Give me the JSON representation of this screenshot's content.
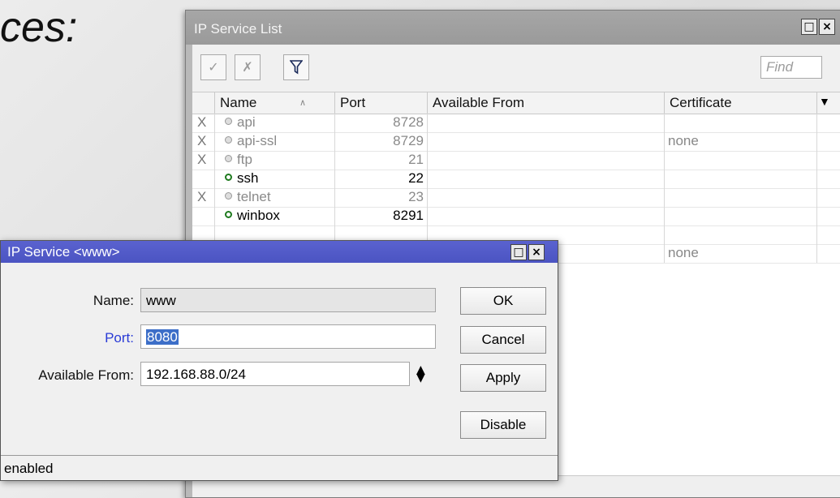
{
  "slide": {
    "text_fragment": "ces:"
  },
  "list_window": {
    "title": "IP Service List",
    "toolbar": {
      "enable_icon": "✓",
      "disable_icon": "✗",
      "filter_icon": "filter-icon",
      "find_placeholder": "Find"
    },
    "columns": [
      "Name",
      "Port",
      "Available From",
      "Certificate"
    ],
    "rows": [
      {
        "flag": "X",
        "name": "api",
        "port": "8728",
        "available_from": "",
        "certificate": "",
        "enabled": false
      },
      {
        "flag": "X",
        "name": "api-ssl",
        "port": "8729",
        "available_from": "",
        "certificate": "none",
        "enabled": false
      },
      {
        "flag": "X",
        "name": "ftp",
        "port": "21",
        "available_from": "",
        "certificate": "",
        "enabled": false
      },
      {
        "flag": "",
        "name": "ssh",
        "port": "22",
        "available_from": "",
        "certificate": "",
        "enabled": true
      },
      {
        "flag": "X",
        "name": "telnet",
        "port": "23",
        "available_from": "",
        "certificate": "",
        "enabled": false
      },
      {
        "flag": "",
        "name": "winbox",
        "port": "8291",
        "available_from": "",
        "certificate": "",
        "enabled": true
      },
      {
        "flag": "",
        "name": "",
        "port": "",
        "available_from": "",
        "certificate": "",
        "enabled": true
      },
      {
        "flag": "",
        "name": "",
        "port": "",
        "available_from": "",
        "certificate": "none",
        "enabled": true
      }
    ]
  },
  "dialog": {
    "title": "IP Service <www>",
    "name_label": "Name:",
    "name_value": "www",
    "port_label": "Port:",
    "port_value": "8080",
    "available_from_label": "Available From:",
    "available_from_value": "192.168.88.0/24",
    "buttons": {
      "ok": "OK",
      "cancel": "Cancel",
      "apply": "Apply",
      "disable": "Disable"
    },
    "status": "enabled"
  },
  "colors": {
    "dialog_title_bar": "#4b54c2",
    "list_title_bar": "#9e9e9e",
    "port_label": "#2a3bd6",
    "enabled_dot": "#1f7a1f"
  }
}
